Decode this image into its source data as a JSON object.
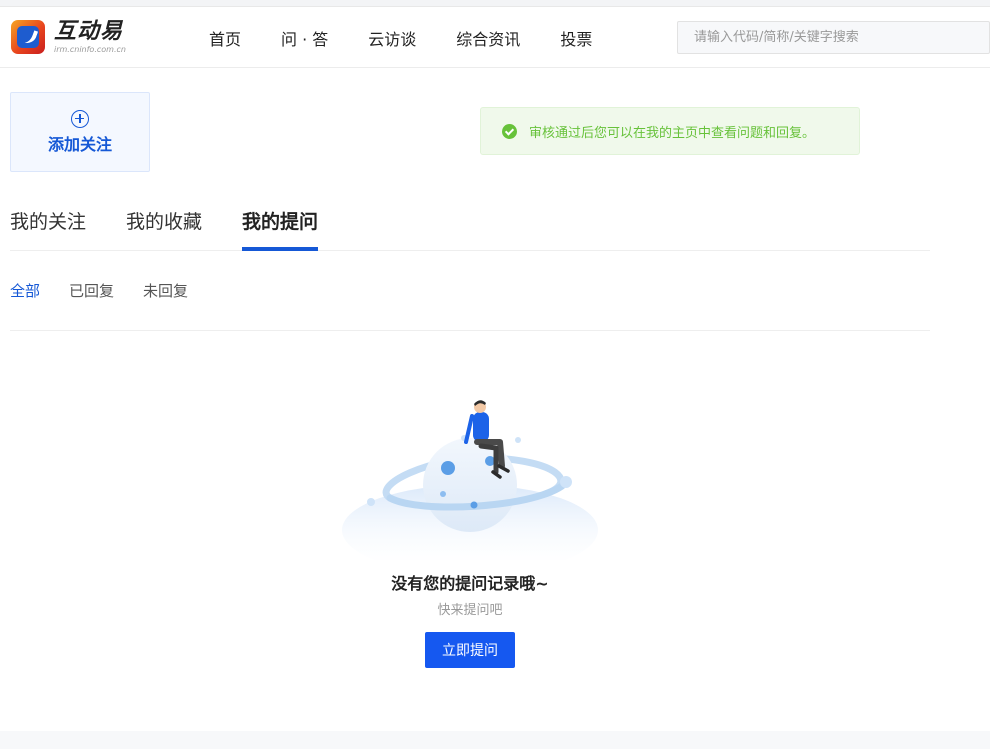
{
  "brand": {
    "name": "互动易",
    "url_text": "irm.cninfo.com.cn"
  },
  "nav": {
    "items": [
      "首页",
      "问 · 答",
      "云访谈",
      "综合资讯",
      "投票"
    ]
  },
  "search": {
    "placeholder": "请输入代码/简称/关键字搜索"
  },
  "follow": {
    "label": "添加关注"
  },
  "notice": {
    "text": "审核通过后您可以在我的主页中查看问题和回复。"
  },
  "tabs": [
    {
      "label": "我的关注",
      "active": false
    },
    {
      "label": "我的收藏",
      "active": false
    },
    {
      "label": "我的提问",
      "active": true
    }
  ],
  "subtabs": [
    {
      "label": "全部",
      "active": true
    },
    {
      "label": "已回复",
      "active": false
    },
    {
      "label": "未回复",
      "active": false
    }
  ],
  "empty": {
    "title": "没有您的提问记录哦~",
    "subtitle": "快来提问吧",
    "button": "立即提问"
  },
  "colors": {
    "primary": "#1558d6",
    "button": "#1558f0",
    "success": "#67c23a",
    "notice_bg": "#f0f9eb"
  }
}
